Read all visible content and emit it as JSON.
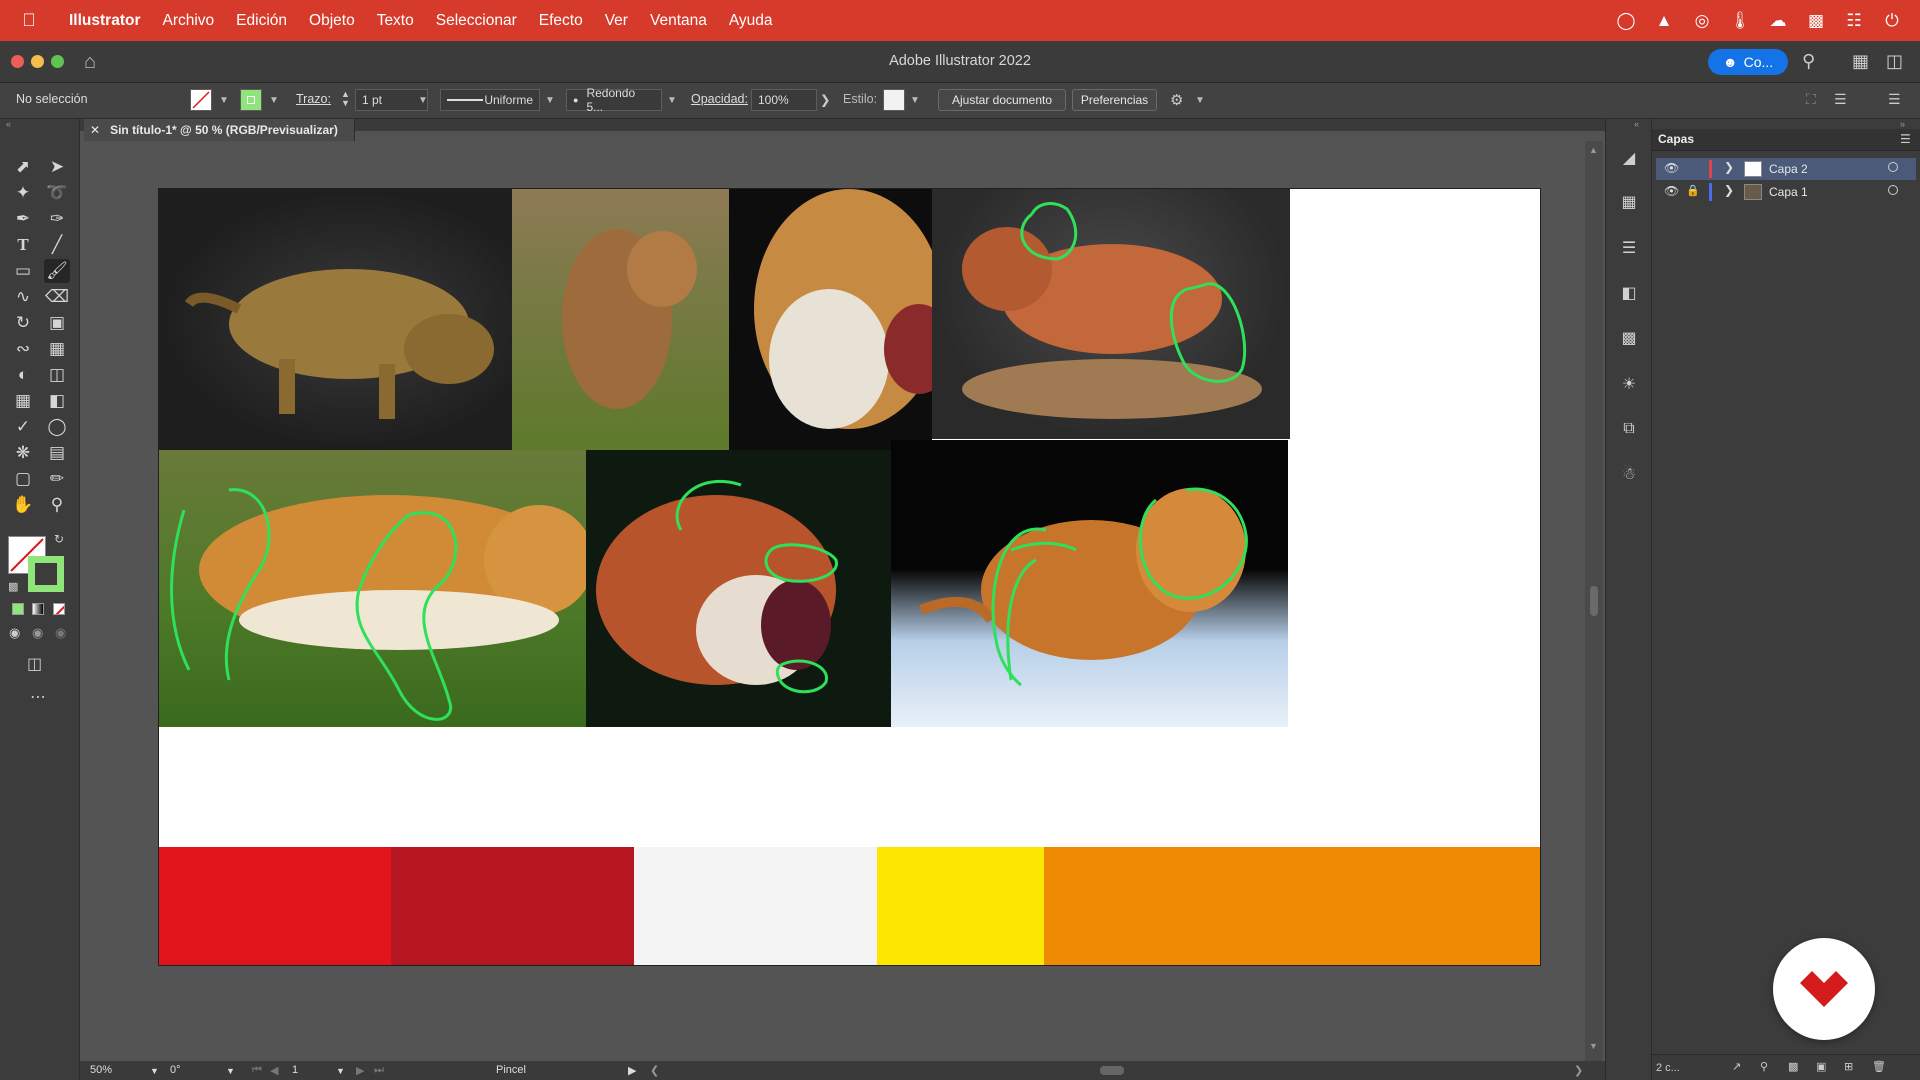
{
  "menubar": {
    "app": "Illustrator",
    "items": [
      "Archivo",
      "Edición",
      "Objeto",
      "Texto",
      "Seleccionar",
      "Efecto",
      "Ver",
      "Ventana",
      "Ayuda"
    ]
  },
  "window": {
    "title": "Adobe Illustrator 2022",
    "cc_button": "Co..."
  },
  "controlbar": {
    "selection": "No selección",
    "stroke_label": "Trazo:",
    "stroke_value": "1 pt",
    "profile": "Uniforme",
    "brush": "Redondo 5...",
    "opacity_label": "Opacidad:",
    "opacity_value": "100%",
    "style_label": "Estilo:",
    "fit_button": "Ajustar documento",
    "prefs_button": "Preferencias"
  },
  "document": {
    "tab_title": "Sin título-1* @ 50 % (RGB/Previsualizar)"
  },
  "palette": [
    "#e2141b",
    "#b5161f",
    "#f4f4f4",
    "#fde601",
    "#ee8a04"
  ],
  "layers": {
    "title": "Capas",
    "items": [
      {
        "name": "Capa 2",
        "color": "#e0434c",
        "selected": true
      },
      {
        "name": "Capa 1",
        "color": "#4a6cf0",
        "selected": false
      }
    ],
    "footer_count": "2 c..."
  },
  "statusbar": {
    "zoom": "50%",
    "rotation": "0°",
    "artboard": "1",
    "tool": "Pincel"
  }
}
